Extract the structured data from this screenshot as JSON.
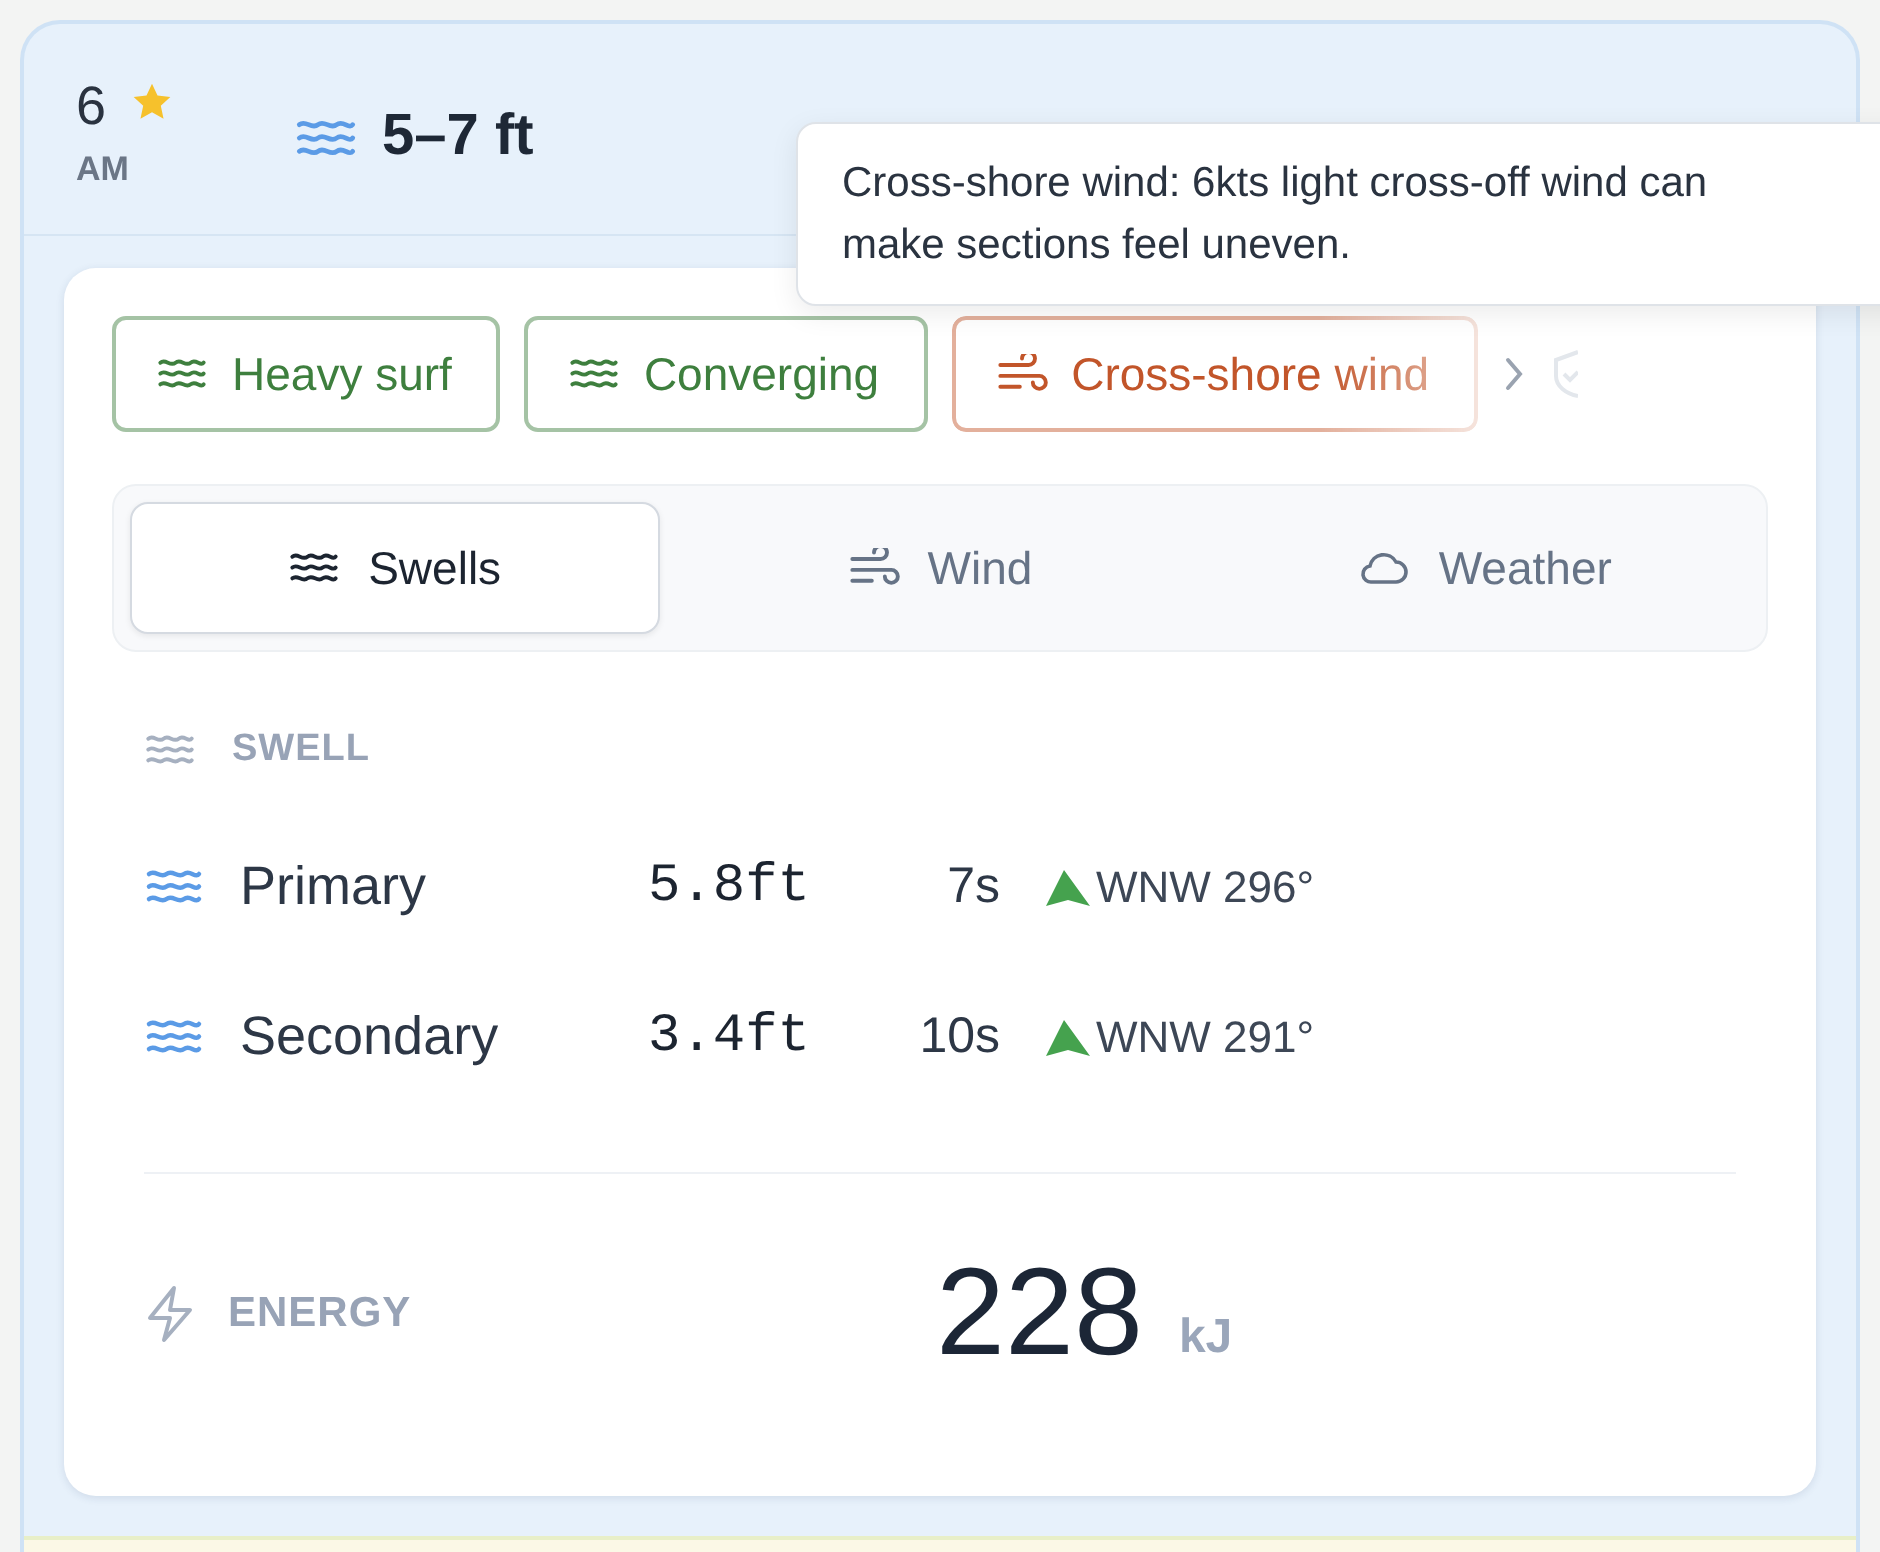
{
  "header": {
    "hour": "6",
    "period": "AM",
    "starred": true,
    "wave_height": "5–7 ft"
  },
  "tooltip": {
    "text": "Cross-shore wind: 6kts light cross-off wind can make sections feel uneven."
  },
  "chips": [
    {
      "label": "Heavy surf",
      "kind": "swell",
      "color": "#3e7f3e"
    },
    {
      "label": "Converging",
      "kind": "swell",
      "color": "#3e7f3e"
    },
    {
      "label": "Cross-shore wind",
      "kind": "wind",
      "color": "#c2552a"
    }
  ],
  "tabs": [
    {
      "label": "Swells",
      "kind": "swell",
      "selected": true
    },
    {
      "label": "Wind",
      "kind": "wind",
      "selected": false
    },
    {
      "label": "Weather",
      "kind": "cloud",
      "selected": false
    }
  ],
  "swell": {
    "title": "SWELL",
    "rows": [
      {
        "name": "Primary",
        "height": "5.8ft",
        "period": "7s",
        "direction": "WNW 296°"
      },
      {
        "name": "Secondary",
        "height": "3.4ft",
        "period": "10s",
        "direction": "WNW 291°"
      }
    ]
  },
  "energy": {
    "label": "ENERGY",
    "value": "228",
    "unit": "kJ"
  }
}
